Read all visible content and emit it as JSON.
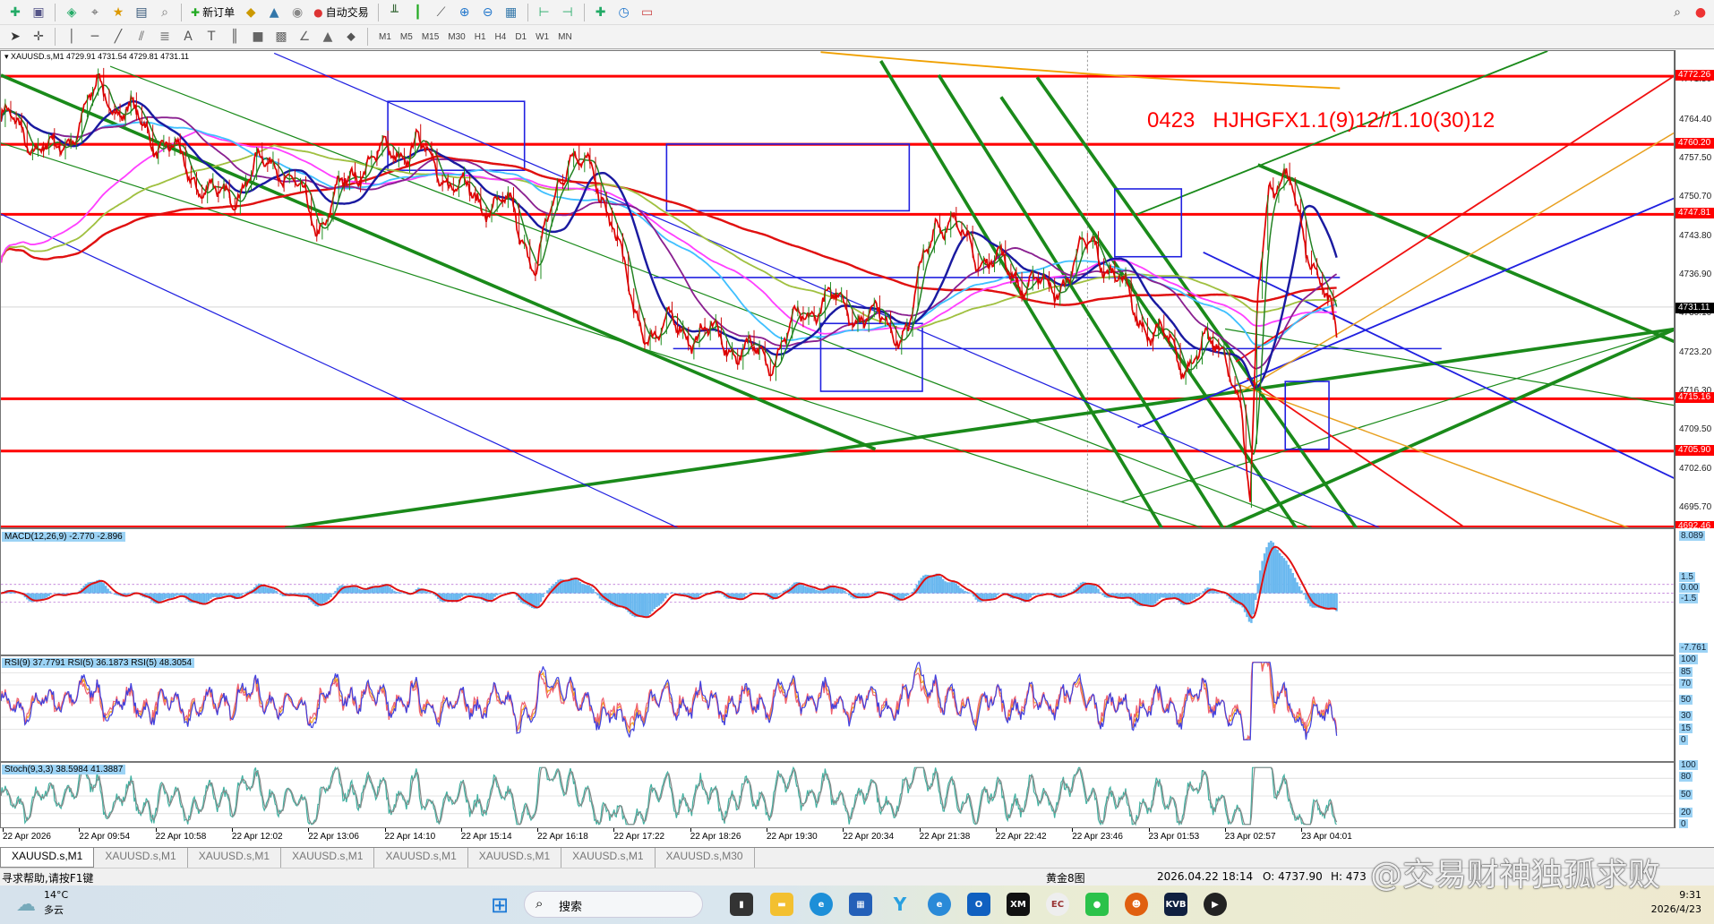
{
  "toolbar": {
    "new_order": "新订单",
    "auto_trading": "自动交易",
    "timeframes": [
      "M1",
      "M5",
      "M15",
      "M30",
      "H1",
      "H4",
      "D1",
      "W1",
      "MN"
    ]
  },
  "chart": {
    "header": "XAUUSD.s,M1  4729.91 4731.54 4729.81 4731.11",
    "annotation": "0423   HJHGFX1.1(9)12//1.10(30)12",
    "price_axis": [
      "4771.50",
      "4764.40",
      "4757.50",
      "4750.70",
      "4743.80",
      "4736.90",
      "4730.10",
      "4723.20",
      "4716.30",
      "4709.50",
      "4702.60",
      "4695.70"
    ],
    "level_tags": [
      "4772.26",
      "4760.20",
      "4747.81",
      "4715.16",
      "4705.90",
      "4692.46"
    ],
    "current_price": "4731.11",
    "price_waypoints": [
      [
        0,
        4765
      ],
      [
        50,
        4758
      ],
      [
        90,
        4770
      ],
      [
        150,
        4760
      ],
      [
        200,
        4750
      ],
      [
        250,
        4758
      ],
      [
        290,
        4746
      ],
      [
        330,
        4757
      ],
      [
        380,
        4760
      ],
      [
        420,
        4752
      ],
      [
        470,
        4748
      ],
      [
        490,
        4738
      ],
      [
        520,
        4760
      ],
      [
        560,
        4748
      ],
      [
        580,
        4728
      ],
      [
        640,
        4727
      ],
      [
        700,
        4722
      ],
      [
        750,
        4733
      ],
      [
        830,
        4727
      ],
      [
        855,
        4748
      ],
      [
        900,
        4740
      ],
      [
        960,
        4734
      ],
      [
        1000,
        4743
      ],
      [
        1040,
        4730
      ],
      [
        1080,
        4722
      ],
      [
        1120,
        4725
      ],
      [
        1135,
        4712
      ],
      [
        1143,
        4694
      ],
      [
        1150,
        4735
      ],
      [
        1160,
        4754
      ],
      [
        1180,
        4752
      ],
      [
        1200,
        4740
      ],
      [
        1222,
        4726
      ]
    ],
    "colors": {
      "levels": "#ff0000",
      "channels": "#008000",
      "boxes": "#0000ff",
      "price": "#e00000"
    }
  },
  "macd": {
    "label": "MACD(12,26,9) -2.770 -2.896",
    "axis": [
      "8.089",
      "1.5",
      "0.00",
      "-1.5",
      "-7.761"
    ]
  },
  "rsi": {
    "label": "RSI(9) 37.7791  RSI(5) 36.1873  RSI(5) 48.3054",
    "axis": [
      "100",
      "85",
      "70",
      "50",
      "30",
      "15",
      "0"
    ]
  },
  "stoch": {
    "label": "Stoch(9,3,3) 38.5984 41.3887",
    "axis": [
      "100",
      "80",
      "50",
      "20",
      "0"
    ]
  },
  "time_axis": [
    "22 Apr 2026",
    "22 Apr 09:54",
    "22 Apr 10:58",
    "22 Apr 12:02",
    "22 Apr 13:06",
    "22 Apr 14:10",
    "22 Apr 15:14",
    "22 Apr 16:18",
    "22 Apr 17:22",
    "22 Apr 18:26",
    "22 Apr 19:30",
    "22 Apr 20:34",
    "22 Apr 21:38",
    "22 Apr 22:42",
    "22 Apr 23:46",
    "23 Apr 01:53",
    "23 Apr 02:57",
    "23 Apr 04:01"
  ],
  "tabs": [
    "XAUUSD.s,M1",
    "XAUUSD.s,M1",
    "XAUUSD.s,M1",
    "XAUUSD.s,M1",
    "XAUUSD.s,M1",
    "XAUUSD.s,M1",
    "XAUUSD.s,M1",
    "XAUUSD.s,M30"
  ],
  "status": {
    "help": "寻求帮助,请按F1键",
    "profile": "黄金8图",
    "datetime": "2026.04.22 18:14",
    "open": "O: 4737.90",
    "high": "H: 473"
  },
  "watermark": "@交易财神独孤求败",
  "taskbar": {
    "temp": "14°C",
    "weather": "多云",
    "search": "搜索",
    "time": "9:31",
    "date": "2026/4/23"
  }
}
